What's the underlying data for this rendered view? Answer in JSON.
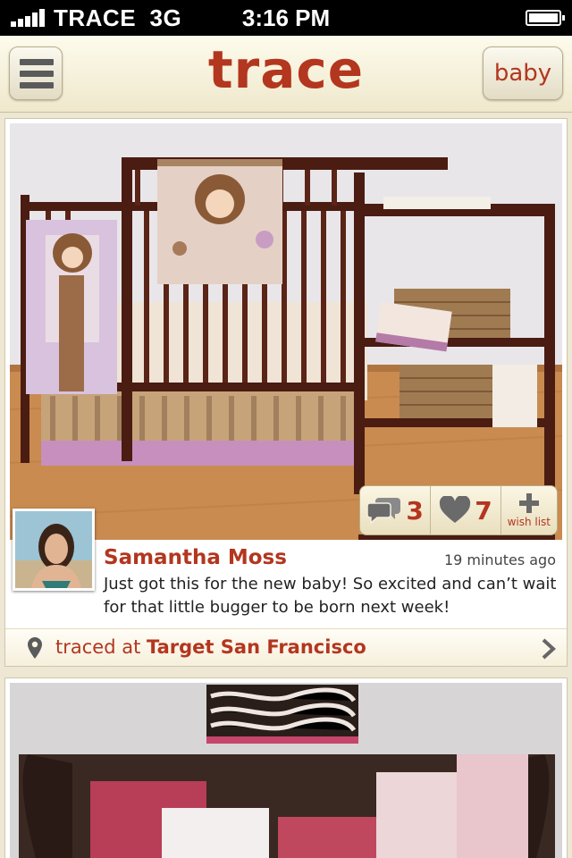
{
  "status_bar": {
    "carrier": "TRACE",
    "network": "3G",
    "time": "3:16 PM"
  },
  "header": {
    "logo": "trace",
    "category_button": "baby"
  },
  "posts": [
    {
      "user": "Samantha Moss",
      "time_ago": "19 minutes ago",
      "caption": "Just got this for the new baby!  So excited and can’t wait for that little bugger to be born next week!",
      "comments_count": "3",
      "likes_count": "7",
      "wishlist_label": "wish list",
      "location_prefix": "traced at",
      "location_name": "Target San Francisco"
    }
  ],
  "colors": {
    "accent": "#b3361f",
    "background": "#ede7d4",
    "header": "#f7f2dc"
  },
  "icons": [
    "menu-icon",
    "comment-icon",
    "heart-icon",
    "plus-icon",
    "location-pin-icon",
    "chevron-right-icon",
    "signal-icon",
    "battery-icon"
  ]
}
